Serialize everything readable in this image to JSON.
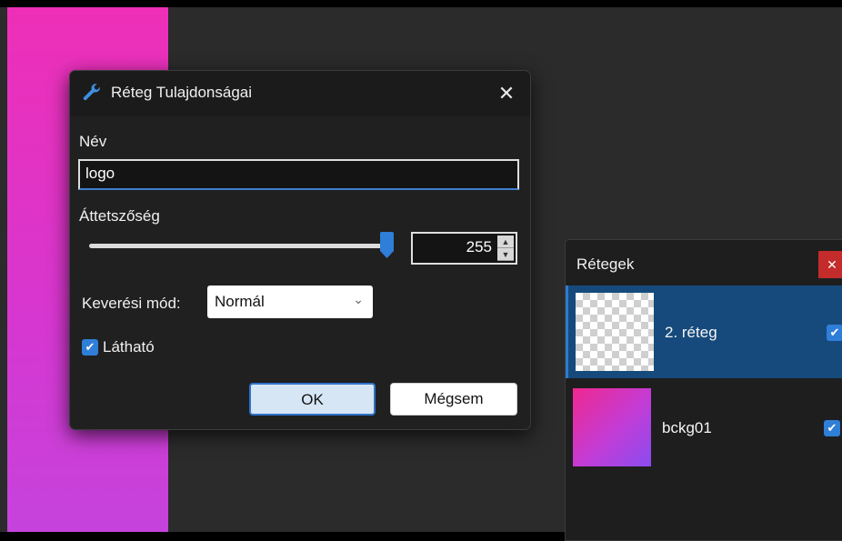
{
  "dialog": {
    "title": "Réteg Tulajdonságai",
    "name_label": "Név",
    "name_value": "logo",
    "opacity_label": "Áttetszőség",
    "opacity_value": "255",
    "opacity_fraction": 1.0,
    "blend_label": "Keverési mód:",
    "blend_value": "Normál",
    "visible_label": "Látható",
    "visible_checked": true,
    "ok_label": "OK",
    "cancel_label": "Mégsem",
    "close_glyph": "✕"
  },
  "layers_panel": {
    "title": "Rétegek",
    "close_glyph": "✕",
    "layers": [
      {
        "name": "2. réteg",
        "selected": true,
        "visible": true,
        "thumbnail": "transparent-checker"
      },
      {
        "name": "bckg01",
        "selected": false,
        "visible": true,
        "thumbnail": "pink-purple-gradient"
      }
    ]
  },
  "icons": {
    "title_icon": "wrench-icon",
    "check_glyph": "✔",
    "chevron_down": "⌄",
    "spin_up": "▲",
    "spin_down": "▼"
  },
  "colors": {
    "accent": "#2f7ed8",
    "selected_row": "#164a7c",
    "close_red": "#c42b2b"
  }
}
